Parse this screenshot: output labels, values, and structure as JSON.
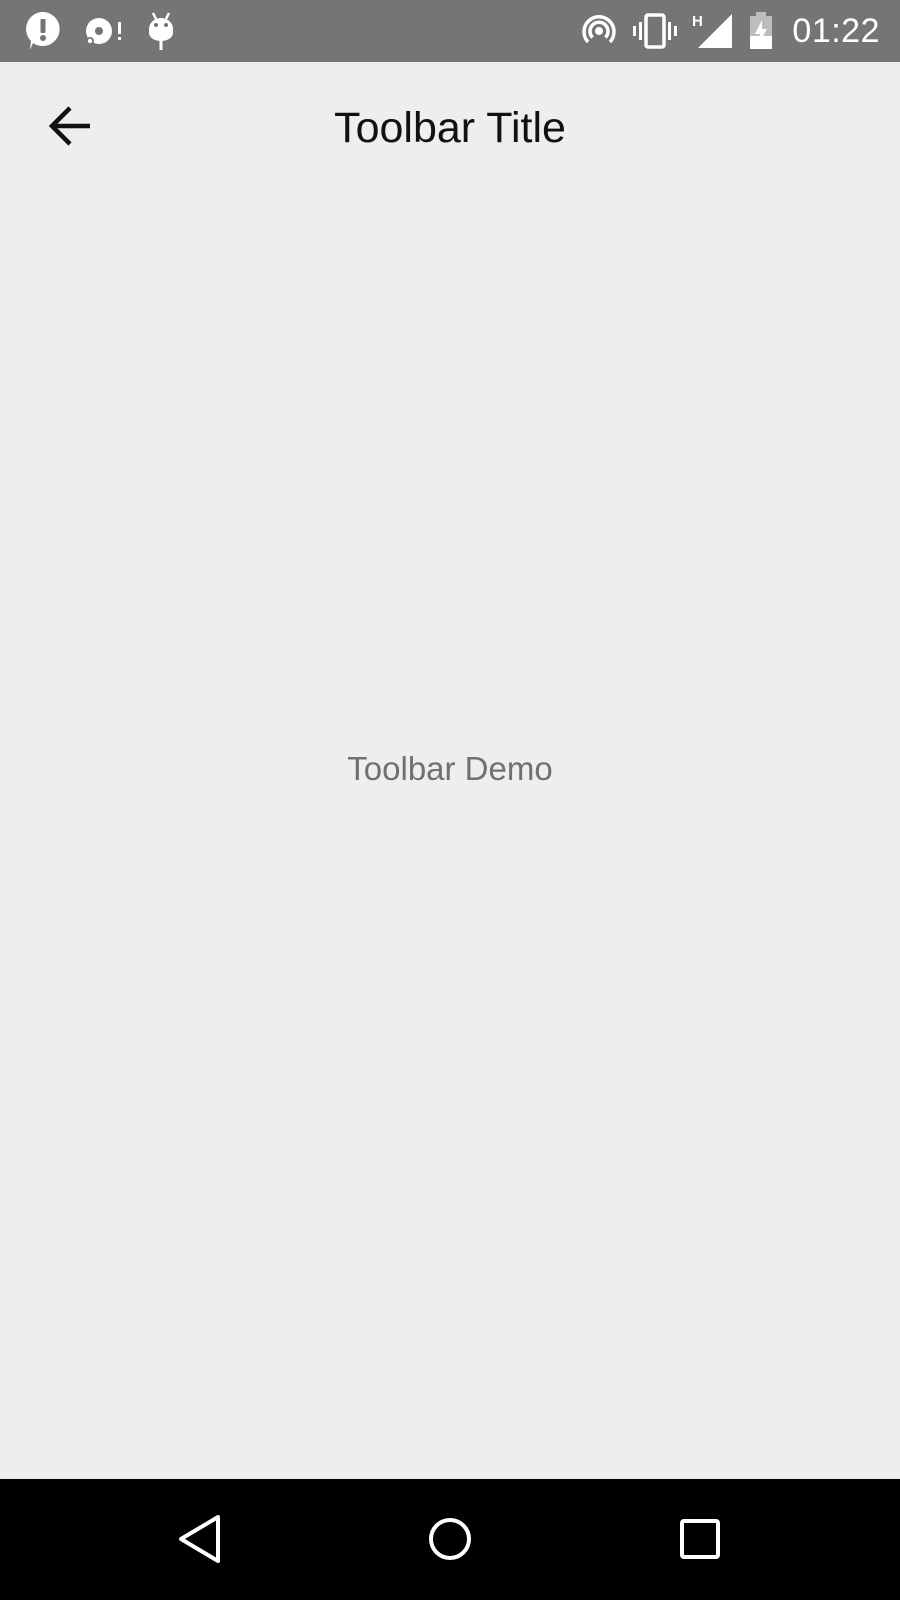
{
  "status_bar": {
    "notification_icons": [
      "alert-bubble-icon",
      "disc-alert-icon",
      "android-debug-icon"
    ],
    "system_icons": [
      "hotspot-icon",
      "vibrate-icon",
      "signal-h-icon",
      "battery-charging-icon"
    ],
    "signal_type": "H",
    "time": "01:22",
    "background_color": "#757575"
  },
  "toolbar": {
    "title": "Toolbar Title",
    "back_icon": "arrow-back-icon"
  },
  "content": {
    "demo_text": "Toolbar Demo"
  },
  "nav_bar": {
    "buttons": [
      "nav-back-icon",
      "nav-home-icon",
      "nav-recents-icon"
    ]
  },
  "colors": {
    "background": "#eeeeee",
    "title": "#111111",
    "demo_text": "#707070",
    "nav_bar": "#000000"
  }
}
